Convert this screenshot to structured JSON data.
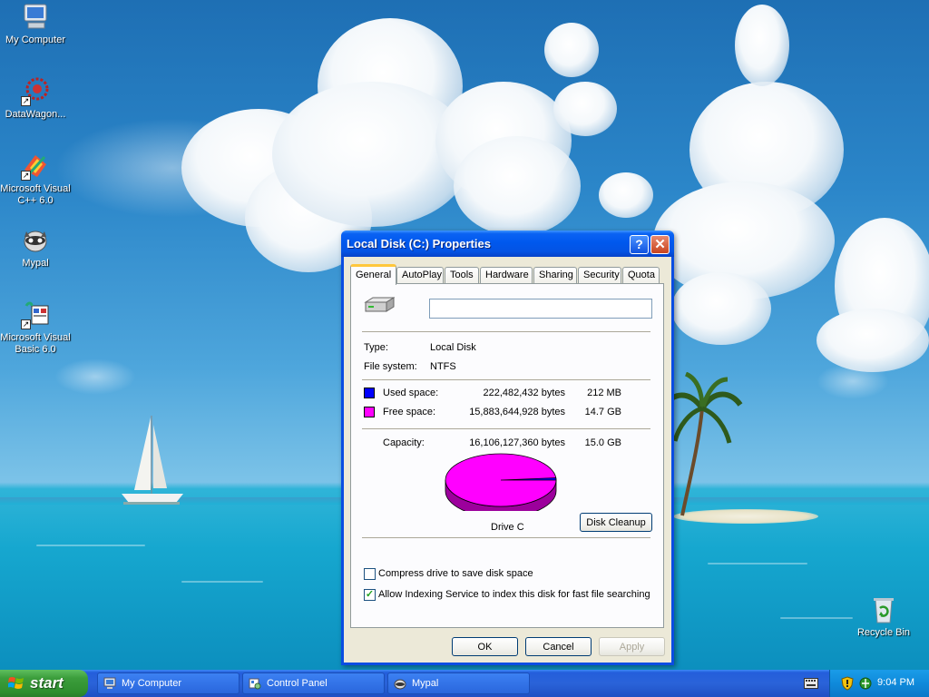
{
  "desktop": {
    "icons": [
      {
        "label": "My Computer",
        "icon": "my-computer-icon"
      },
      {
        "label": "DataWagon...",
        "icon": "datawagon-icon"
      },
      {
        "label": "Microsoft Visual C++ 6.0",
        "icon": "visual-cpp-icon"
      },
      {
        "label": "Mypal",
        "icon": "mypal-icon"
      },
      {
        "label": "Microsoft Visual Basic 6.0",
        "icon": "visual-basic-icon"
      },
      {
        "label": "Recycle Bin",
        "icon": "recycle-bin-icon"
      }
    ]
  },
  "dialog": {
    "title": "Local Disk (C:) Properties",
    "help_glyph": "?",
    "close_glyph": "✕",
    "tabs": [
      "General",
      "AutoPlay",
      "Tools",
      "Hardware",
      "Sharing",
      "Security",
      "Quota"
    ],
    "active_tab": "General",
    "volume_label_value": "",
    "type_label": "Type:",
    "type_value": "Local Disk",
    "fs_label": "File system:",
    "fs_value": "NTFS",
    "used": {
      "label": "Used space:",
      "bytes": "222,482,432 bytes",
      "size": "212 MB",
      "color": "#0000ff"
    },
    "free": {
      "label": "Free space:",
      "bytes": "15,883,644,928 bytes",
      "size": "14.7 GB",
      "color": "#ff00ff"
    },
    "capacity": {
      "label": "Capacity:",
      "bytes": "16,106,127,360 bytes",
      "size": "15.0 GB"
    },
    "used_fraction": 0.0138,
    "drive_label": "Drive C",
    "disk_cleanup_label": "Disk Cleanup",
    "compress": {
      "label": "Compress drive to save disk space",
      "checked": false
    },
    "indexing": {
      "label": "Allow Indexing Service to index this disk for fast file searching",
      "checked": true,
      "mark": "✓"
    },
    "ok_label": "OK",
    "cancel_label": "Cancel",
    "apply_label": "Apply"
  },
  "taskbar": {
    "start_label": "start",
    "tasks": [
      {
        "label": "My Computer",
        "icon": "my-computer-icon"
      },
      {
        "label": "Control Panel",
        "icon": "control-panel-icon"
      },
      {
        "label": "Mypal",
        "icon": "mypal-icon"
      }
    ],
    "clock": "9:04 PM"
  }
}
